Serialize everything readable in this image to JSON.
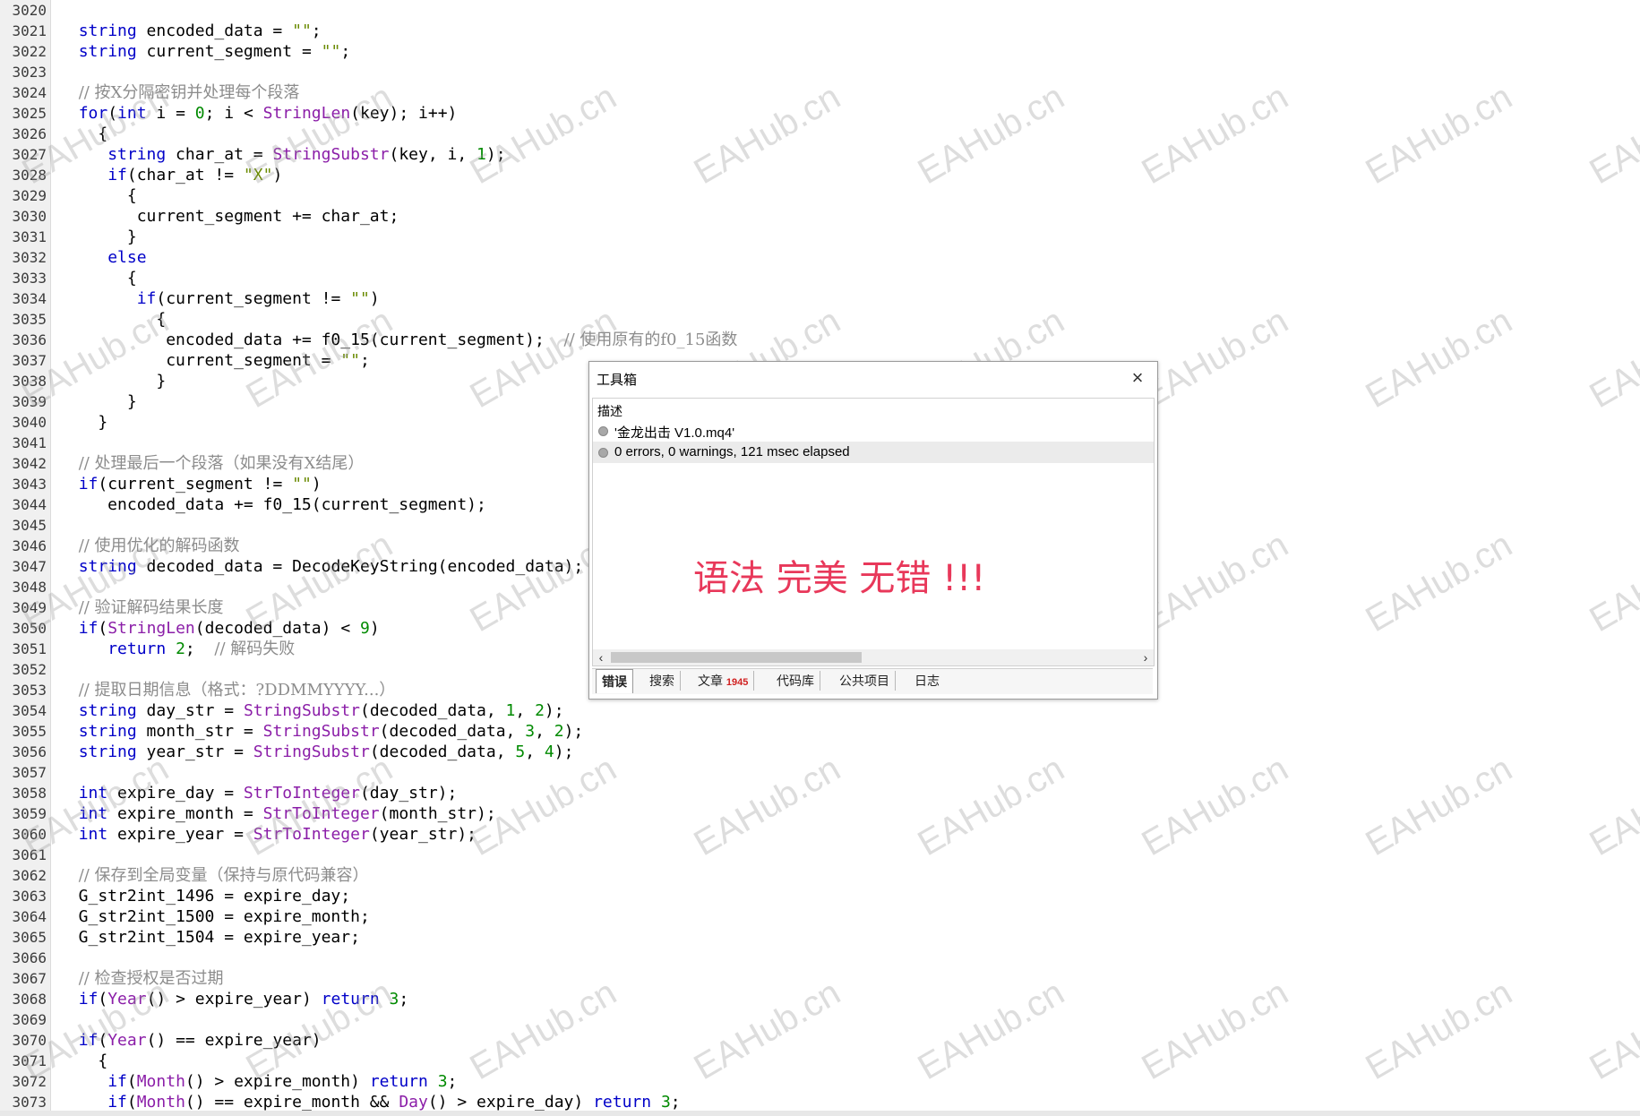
{
  "editor": {
    "lines": [
      {
        "n": "3020",
        "html": ""
      },
      {
        "n": "3021",
        "html": "  <span class=\"kw\">string</span> encoded_data = <span class=\"st\">\"\"</span>;"
      },
      {
        "n": "3022",
        "html": "  <span class=\"kw\">string</span> current_segment = <span class=\"st\">\"\"</span>;"
      },
      {
        "n": "3023",
        "html": ""
      },
      {
        "n": "3024",
        "html": "  <span class=\"cm\">// 按X分隔密钥并处理每个段落</span>"
      },
      {
        "n": "3025",
        "html": "  <span class=\"kw\">for</span>(<span class=\"kw\">int</span> i = <span class=\"nm\">0</span>; i &lt; <span class=\"fn\">StringLen</span>(key); i++)"
      },
      {
        "n": "3026",
        "html": "    {"
      },
      {
        "n": "3027",
        "html": "     <span class=\"kw\">string</span> char_at = <span class=\"fn\">StringSubstr</span>(key, i, <span class=\"nm\">1</span>);"
      },
      {
        "n": "3028",
        "html": "     <span class=\"kw\">if</span>(char_at != <span class=\"st\">\"X\"</span>)"
      },
      {
        "n": "3029",
        "html": "       {"
      },
      {
        "n": "3030",
        "html": "        current_segment += char_at;"
      },
      {
        "n": "3031",
        "html": "       }"
      },
      {
        "n": "3032",
        "html": "     <span class=\"kw\">else</span>"
      },
      {
        "n": "3033",
        "html": "       {"
      },
      {
        "n": "3034",
        "html": "        <span class=\"kw\">if</span>(current_segment != <span class=\"st\">\"\"</span>)"
      },
      {
        "n": "3035",
        "html": "          {"
      },
      {
        "n": "3036",
        "html": "           encoded_data += f0_15(current_segment);  <span class=\"cm\">// 使用原有的f0_15函数</span>"
      },
      {
        "n": "3037",
        "html": "           current_segment = <span class=\"st\">\"\"</span>;"
      },
      {
        "n": "3038",
        "html": "          }"
      },
      {
        "n": "3039",
        "html": "       }"
      },
      {
        "n": "3040",
        "html": "    }"
      },
      {
        "n": "3041",
        "html": ""
      },
      {
        "n": "3042",
        "html": "  <span class=\"cm\">// 处理最后一个段落（如果没有X结尾）</span>"
      },
      {
        "n": "3043",
        "html": "  <span class=\"kw\">if</span>(current_segment != <span class=\"st\">\"\"</span>)"
      },
      {
        "n": "3044",
        "html": "     encoded_data += f0_15(current_segment);"
      },
      {
        "n": "3045",
        "html": ""
      },
      {
        "n": "3046",
        "html": "  <span class=\"cm\">// 使用优化的解码函数</span>"
      },
      {
        "n": "3047",
        "html": "  <span class=\"kw\">string</span> decoded_data = DecodeKeyString(encoded_data);"
      },
      {
        "n": "3048",
        "html": ""
      },
      {
        "n": "3049",
        "html": "  <span class=\"cm\">// 验证解码结果长度</span>"
      },
      {
        "n": "3050",
        "html": "  <span class=\"kw\">if</span>(<span class=\"fn\">StringLen</span>(decoded_data) &lt; <span class=\"nm\">9</span>)"
      },
      {
        "n": "3051",
        "html": "     <span class=\"kw\">return</span> <span class=\"nm\">2</span>;  <span class=\"cm\">// 解码失败</span>"
      },
      {
        "n": "3052",
        "html": ""
      },
      {
        "n": "3053",
        "html": "  <span class=\"cm\">// 提取日期信息（格式：?DDMMYYYY...）</span>"
      },
      {
        "n": "3054",
        "html": "  <span class=\"kw\">string</span> day_str = <span class=\"fn\">StringSubstr</span>(decoded_data, <span class=\"nm\">1</span>, <span class=\"nm\">2</span>);"
      },
      {
        "n": "3055",
        "html": "  <span class=\"kw\">string</span> month_str = <span class=\"fn\">StringSubstr</span>(decoded_data, <span class=\"nm\">3</span>, <span class=\"nm\">2</span>);"
      },
      {
        "n": "3056",
        "html": "  <span class=\"kw\">string</span> year_str = <span class=\"fn\">StringSubstr</span>(decoded_data, <span class=\"nm\">5</span>, <span class=\"nm\">4</span>);"
      },
      {
        "n": "3057",
        "html": ""
      },
      {
        "n": "3058",
        "html": "  <span class=\"kw\">int</span> expire_day = <span class=\"fn\">StrToInteger</span>(day_str);"
      },
      {
        "n": "3059",
        "html": "  <span class=\"kw\">int</span> expire_month = <span class=\"fn\">StrToInteger</span>(month_str);"
      },
      {
        "n": "3060",
        "html": "  <span class=\"kw\">int</span> expire_year = <span class=\"fn\">StrToInteger</span>(year_str);"
      },
      {
        "n": "3061",
        "html": ""
      },
      {
        "n": "3062",
        "html": "  <span class=\"cm\">// 保存到全局变量（保持与原代码兼容）</span>"
      },
      {
        "n": "3063",
        "html": "  G_str2int_1496 = expire_day;"
      },
      {
        "n": "3064",
        "html": "  G_str2int_1500 = expire_month;"
      },
      {
        "n": "3065",
        "html": "  G_str2int_1504 = expire_year;"
      },
      {
        "n": "3066",
        "html": ""
      },
      {
        "n": "3067",
        "html": "  <span class=\"cm\">// 检查授权是否过期</span>"
      },
      {
        "n": "3068",
        "html": "  <span class=\"kw\">if</span>(<span class=\"fn\">Year</span>() &gt; expire_year) <span class=\"kw\">return</span> <span class=\"nm\">3</span>;"
      },
      {
        "n": "3069",
        "html": ""
      },
      {
        "n": "3070",
        "html": "  <span class=\"kw\">if</span>(<span class=\"fn\">Year</span>() == expire_year)"
      },
      {
        "n": "3071",
        "html": "    {"
      },
      {
        "n": "3072",
        "html": "     <span class=\"kw\">if</span>(<span class=\"fn\">Month</span>() &gt; expire_month) <span class=\"kw\">return</span> <span class=\"nm\">3</span>;"
      },
      {
        "n": "3073",
        "html": "     <span class=\"kw\">if</span>(<span class=\"fn\">Month</span>() == expire_month &amp;&amp; <span class=\"fn\">Day</span>() &gt; expire_day) <span class=\"kw\">return</span> <span class=\"nm\">3</span>;"
      }
    ]
  },
  "watermark": {
    "text": "EAHub.cn"
  },
  "toolbox": {
    "title": "工具箱",
    "close_icon": "close-icon",
    "header": "描述",
    "rows": [
      {
        "text": "'金龙出击 V1.0.mq4'"
      },
      {
        "text": "0 errors, 0 warnings, 121 msec elapsed"
      }
    ],
    "banner": "语法 完美 无错 !!!",
    "tabs": [
      {
        "label": "错误"
      },
      {
        "label": "搜索"
      },
      {
        "label": "文章",
        "badge": "1945"
      },
      {
        "label": "代码库"
      },
      {
        "label": "公共项目"
      },
      {
        "label": "日志"
      }
    ]
  }
}
